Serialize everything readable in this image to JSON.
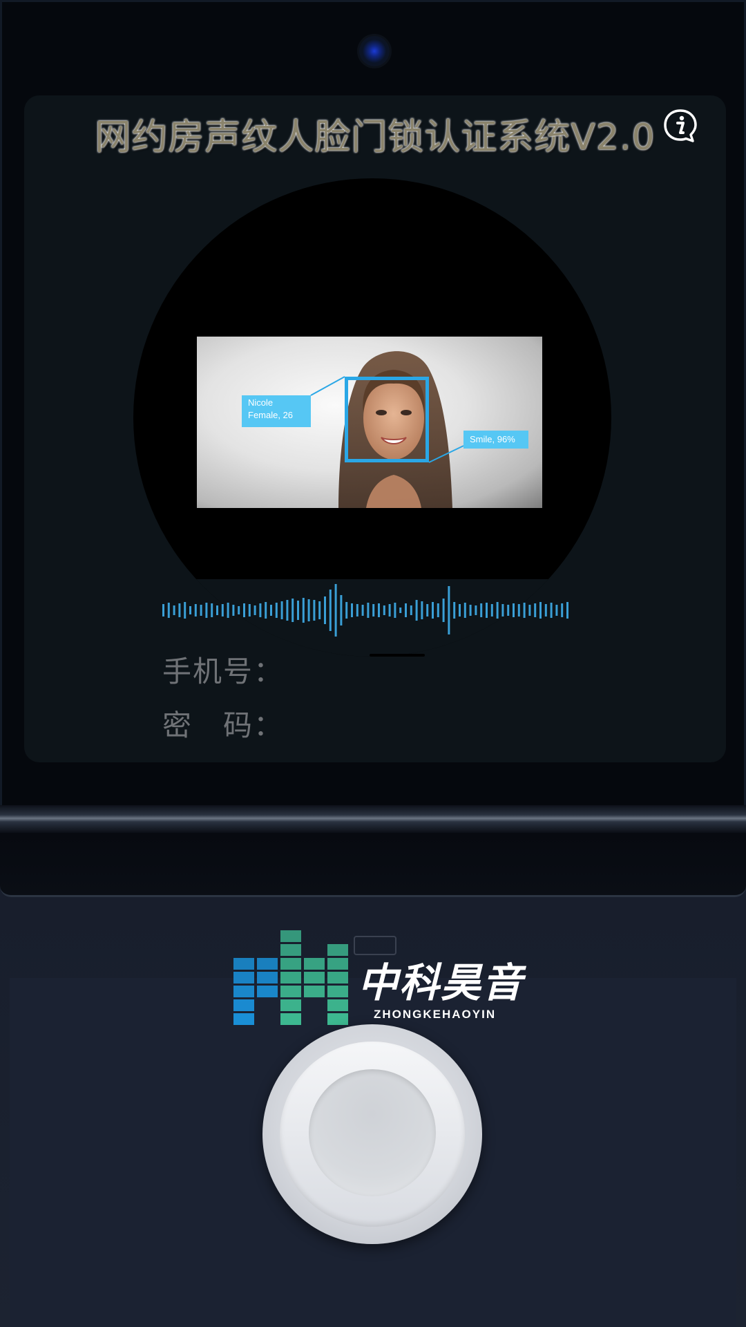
{
  "screen": {
    "title": "网约房声纹人脸门锁认证系统V2.0",
    "info_icon": "info-icon"
  },
  "face_detection": {
    "identity_name": "Nicole",
    "identity_detail": "Female, 26",
    "expression": "Smile, 96%"
  },
  "form": {
    "phone_label": "手机号：",
    "password_label": "密　码："
  },
  "brand": {
    "name_cn": "中科昊音",
    "name_en": "ZHONGKEHAOYIN",
    "logo_icon": "equalizer-bars-logo"
  },
  "colors": {
    "accent_blue": "#2aa7e6",
    "tag_blue": "#56c7f4",
    "wave_blue": "#3a9fd6",
    "logo_blue": "#1a8fd6",
    "logo_green": "#3db890"
  }
}
